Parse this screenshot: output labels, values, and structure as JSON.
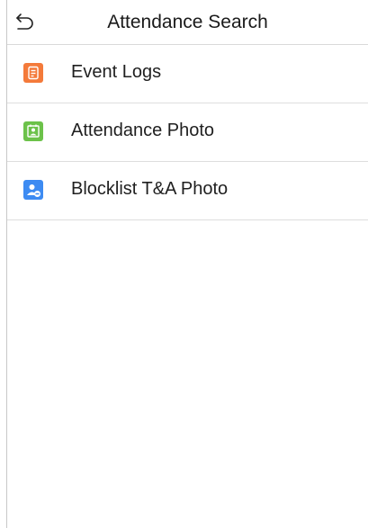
{
  "header": {
    "title": "Attendance Search",
    "back_icon": "back-arrow-icon"
  },
  "menu": {
    "items": [
      {
        "label": "Event Logs",
        "icon": "event-logs-icon",
        "color": "#F47A3A"
      },
      {
        "label": "Attendance Photo",
        "icon": "attendance-photo-icon",
        "color": "#6CC24A"
      },
      {
        "label": "Blocklist T&A Photo",
        "icon": "blocklist-photo-icon",
        "color": "#3D8BF2"
      }
    ]
  }
}
